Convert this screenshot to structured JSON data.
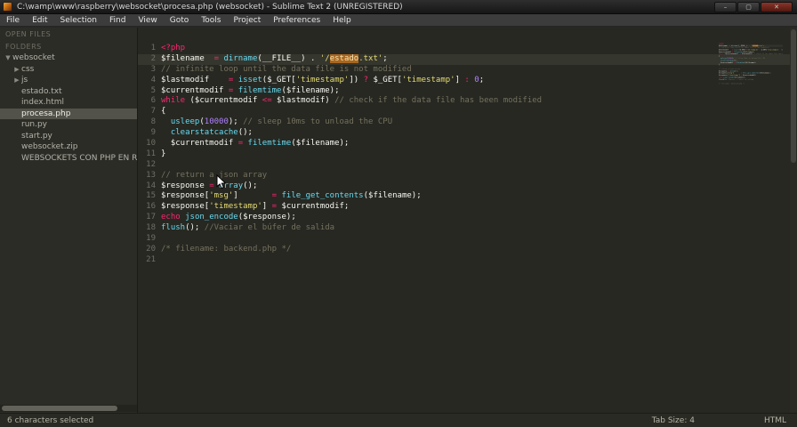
{
  "window": {
    "title": "C:\\wamp\\www\\raspberry\\websocket\\procesa.php (websocket) - Sublime Text 2 (UNREGISTERED)",
    "minimize_glyph": "–",
    "maximize_glyph": "▢",
    "close_glyph": "✕"
  },
  "menu": {
    "items": [
      "File",
      "Edit",
      "Selection",
      "Find",
      "View",
      "Goto",
      "Tools",
      "Project",
      "Preferences",
      "Help"
    ]
  },
  "sidebar": {
    "open_files_label": "OPEN FILES",
    "folders_label": "FOLDERS",
    "tree": [
      {
        "label": "websocket",
        "type": "folder-open",
        "depth": 0,
        "selected": false
      },
      {
        "label": "css",
        "type": "folder",
        "depth": 1,
        "selected": false
      },
      {
        "label": "js",
        "type": "folder",
        "depth": 1,
        "selected": false
      },
      {
        "label": "estado.txt",
        "type": "file",
        "depth": 1,
        "selected": false
      },
      {
        "label": "index.html",
        "type": "file",
        "depth": 1,
        "selected": false
      },
      {
        "label": "procesa.php",
        "type": "file",
        "depth": 1,
        "selected": true
      },
      {
        "label": "run.py",
        "type": "file",
        "depth": 1,
        "selected": false
      },
      {
        "label": "start.py",
        "type": "file",
        "depth": 1,
        "selected": false
      },
      {
        "label": "websocket.zip",
        "type": "file",
        "depth": 1,
        "selected": false
      },
      {
        "label": "WEBSOCKETS CON PHP EN  RASPBERRY.B",
        "type": "file",
        "depth": 1,
        "selected": false
      }
    ]
  },
  "editor": {
    "selected_word": "estado",
    "lines": [
      {
        "n": 1,
        "tokens": [
          [
            "p",
            "<?php"
          ]
        ]
      },
      {
        "n": 2,
        "current": true,
        "tokens": [
          [
            "w",
            "$filename  "
          ],
          [
            "p",
            "="
          ],
          [
            "w",
            " "
          ],
          [
            "b",
            "dirname"
          ],
          [
            "w",
            "(__FILE__) . "
          ],
          [
            "y",
            "'/"
          ],
          [
            "s",
            "estado"
          ],
          [
            "y",
            ".txt'"
          ],
          [
            "w",
            ";"
          ]
        ]
      },
      {
        "n": 3,
        "tokens": [
          [
            "c",
            "// infinite loop until the data file is not modified"
          ]
        ]
      },
      {
        "n": 4,
        "tokens": [
          [
            "w",
            "$lastmodif    "
          ],
          [
            "p",
            "="
          ],
          [
            "w",
            " "
          ],
          [
            "b",
            "isset"
          ],
          [
            "w",
            "($_GET["
          ],
          [
            "y",
            "'timestamp'"
          ],
          [
            "w",
            "]) "
          ],
          [
            "p",
            "?"
          ],
          [
            "w",
            " $_GET["
          ],
          [
            "y",
            "'timestamp'"
          ],
          [
            "w",
            "] "
          ],
          [
            "p",
            ":"
          ],
          [
            "w",
            " "
          ],
          [
            "u",
            "0"
          ],
          [
            "w",
            ";"
          ]
        ]
      },
      {
        "n": 5,
        "tokens": [
          [
            "w",
            "$currentmodif "
          ],
          [
            "p",
            "="
          ],
          [
            "w",
            " "
          ],
          [
            "b",
            "filemtime"
          ],
          [
            "w",
            "($filename);"
          ]
        ]
      },
      {
        "n": 6,
        "tokens": [
          [
            "p",
            "while"
          ],
          [
            "w",
            " ($currentmodif "
          ],
          [
            "p",
            "<="
          ],
          [
            "w",
            " $lastmodif) "
          ],
          [
            "c",
            "// check if the data file has been modified"
          ]
        ]
      },
      {
        "n": 7,
        "tokens": [
          [
            "w",
            "{"
          ]
        ]
      },
      {
        "n": 8,
        "tokens": [
          [
            "w",
            "  "
          ],
          [
            "b",
            "usleep"
          ],
          [
            "w",
            "("
          ],
          [
            "u",
            "10000"
          ],
          [
            "w",
            "); "
          ],
          [
            "c",
            "// sleep 10ms to unload the CPU"
          ]
        ]
      },
      {
        "n": 9,
        "tokens": [
          [
            "w",
            "  "
          ],
          [
            "b",
            "clearstatcache"
          ],
          [
            "w",
            "();"
          ]
        ]
      },
      {
        "n": 10,
        "tokens": [
          [
            "w",
            "  $currentmodif "
          ],
          [
            "p",
            "="
          ],
          [
            "w",
            " "
          ],
          [
            "b",
            "filemtime"
          ],
          [
            "w",
            "($filename);"
          ]
        ]
      },
      {
        "n": 11,
        "tokens": [
          [
            "w",
            "}"
          ]
        ]
      },
      {
        "n": 12,
        "tokens": []
      },
      {
        "n": 13,
        "tokens": [
          [
            "c",
            "// return a json array"
          ]
        ]
      },
      {
        "n": 14,
        "tokens": [
          [
            "w",
            "$response "
          ],
          [
            "p",
            "="
          ],
          [
            "w",
            " "
          ],
          [
            "b",
            "array"
          ],
          [
            "w",
            "();"
          ]
        ]
      },
      {
        "n": 15,
        "tokens": [
          [
            "w",
            "$response["
          ],
          [
            "y",
            "'msg'"
          ],
          [
            "w",
            "]       "
          ],
          [
            "p",
            "="
          ],
          [
            "w",
            " "
          ],
          [
            "b",
            "file_get_contents"
          ],
          [
            "w",
            "($filename);"
          ]
        ]
      },
      {
        "n": 16,
        "tokens": [
          [
            "w",
            "$response["
          ],
          [
            "y",
            "'timestamp'"
          ],
          [
            "w",
            "] "
          ],
          [
            "p",
            "="
          ],
          [
            "w",
            " $currentmodif;"
          ]
        ]
      },
      {
        "n": 17,
        "tokens": [
          [
            "p",
            "echo"
          ],
          [
            "w",
            " "
          ],
          [
            "b",
            "json_encode"
          ],
          [
            "w",
            "($response);"
          ]
        ]
      },
      {
        "n": 18,
        "tokens": [
          [
            "b",
            "flush"
          ],
          [
            "w",
            "(); "
          ],
          [
            "c",
            "//Vaciar el búfer de salida"
          ]
        ]
      },
      {
        "n": 19,
        "tokens": []
      },
      {
        "n": 20,
        "tokens": [
          [
            "c",
            "/* filename: backend.php */"
          ]
        ]
      },
      {
        "n": 21,
        "tokens": []
      }
    ]
  },
  "status_bar": {
    "selection_info": "6 characters selected",
    "tab_size": "Tab Size: 4",
    "syntax": "HTML"
  },
  "theme": {
    "background": "#272822",
    "keyword": "#f92672",
    "function": "#66d9ef",
    "string": "#e6db74",
    "number": "#ae81ff",
    "comment": "#75715e",
    "selection": "#a8661f"
  }
}
